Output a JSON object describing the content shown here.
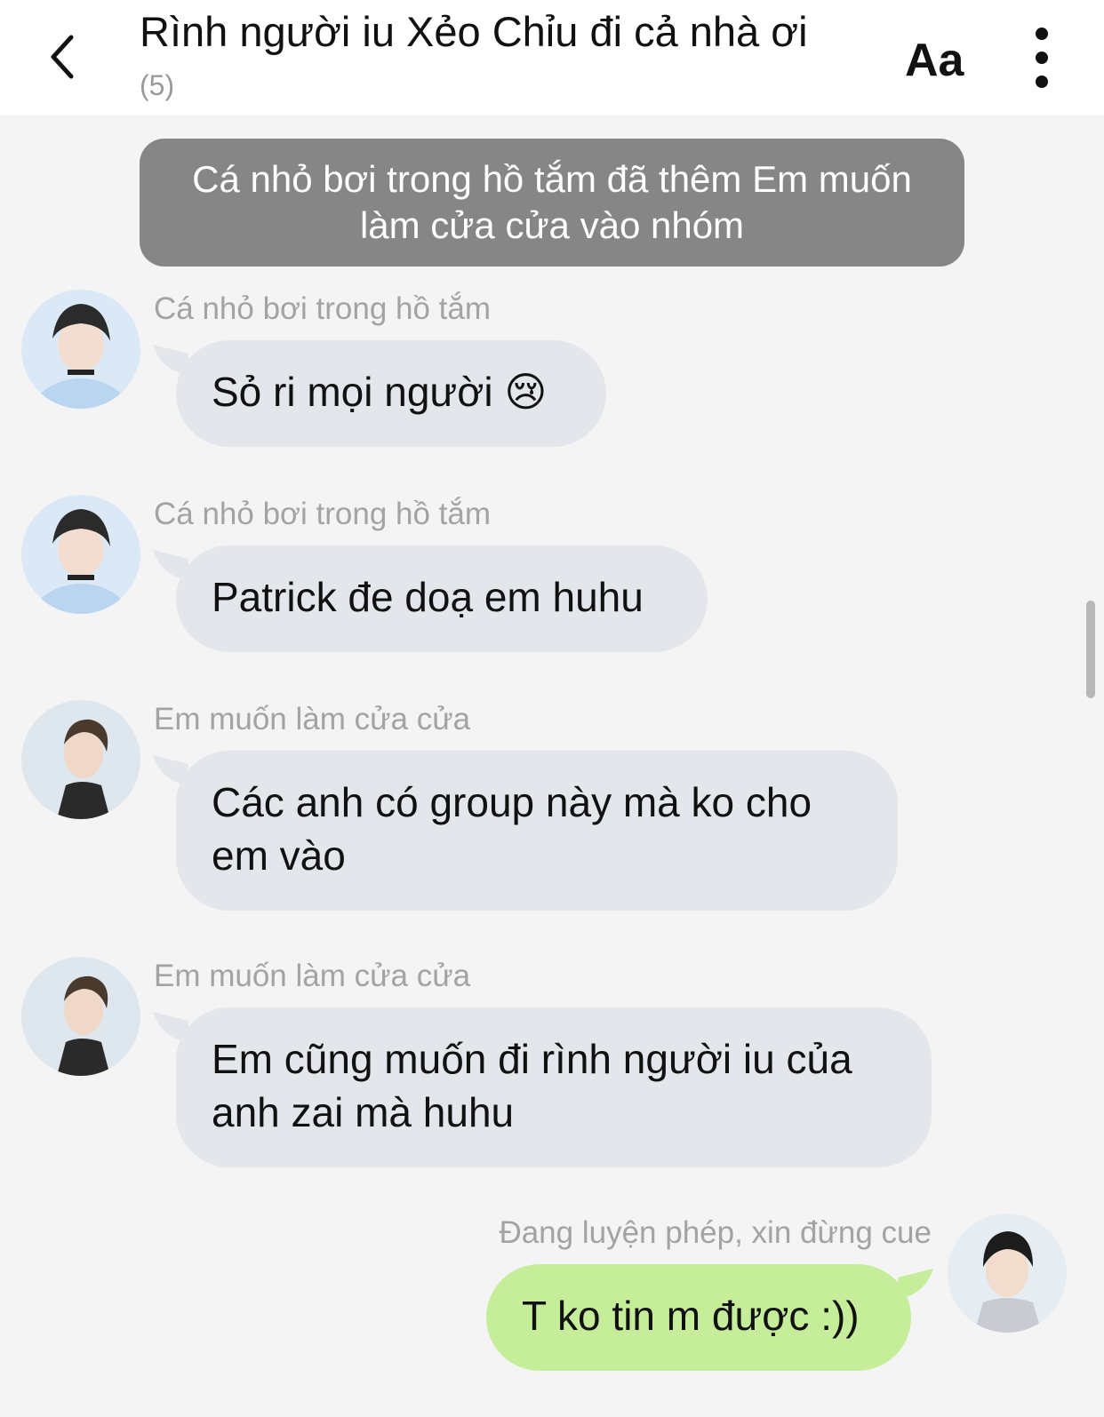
{
  "header": {
    "title": "Rình người iu Xẻo Chỉu đi cả nhà ơi",
    "member_count": "(5)",
    "font_button": "Aa"
  },
  "system_message": "Cá nhỏ bơi trong hồ tắm đã thêm Em muốn làm cửa cửa vào nhóm",
  "messages": [
    {
      "sender": "Cá nhỏ bơi trong hồ tắm",
      "text": "Sỏ ri mọi người 😢"
    },
    {
      "sender": "Cá nhỏ bơi trong hồ tắm",
      "text": "Patrick đe doạ em huhu"
    },
    {
      "sender": "Em muốn làm cửa cửa",
      "text": "Các anh có group này mà ko cho em vào"
    },
    {
      "sender": "Em muốn làm cửa cửa",
      "text": "Em cũng muốn đi rình người iu của anh zai mà huhu"
    },
    {
      "sender": "Đang luyện phép, xin đừng cue",
      "text": "T ko tin m được :))"
    }
  ],
  "colors": {
    "incoming_bubble": "#e3e7eb",
    "outgoing_bubble": "#c6ee9a",
    "system_bubble": "#868686"
  }
}
